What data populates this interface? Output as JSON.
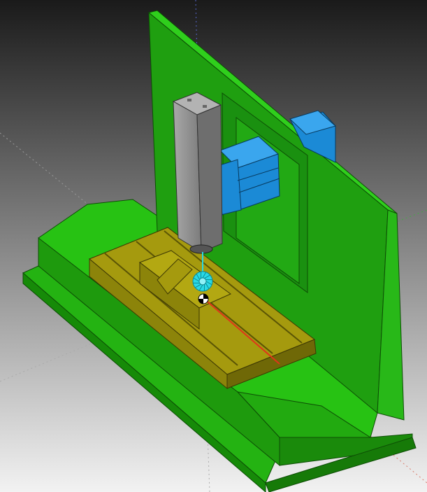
{
  "viewport": {
    "background_top": "#1a1a1a",
    "background_bottom": "#f2f2f2"
  },
  "colors": {
    "base_green_top": "#27c213",
    "base_green_front": "#1e9a0d",
    "base_green_side": "#167a08",
    "column_green_front": "#1f9f10",
    "column_green_side": "#25b616",
    "table_yellow_top": "#a59a0e",
    "table_yellow_front": "#8c840a",
    "table_yellow_side": "#6f6807",
    "spindle_gray_front": "#8f8f8f",
    "spindle_gray_side": "#6e6e6e",
    "spindle_gray_top": "#b3b3b3",
    "slide_blue": "#1b8ad6",
    "slide_blue_dark": "#126aa6",
    "cutter_cyan": "#29d9e6",
    "axis_x": "#e0341a",
    "axis_y": "#33cc33",
    "axis_z": "#3344dd",
    "grid_dotted": "#bbbbbb"
  },
  "icons": {
    "cutter": "milling-cutter-icon",
    "origin": "origin-marker-icon"
  }
}
